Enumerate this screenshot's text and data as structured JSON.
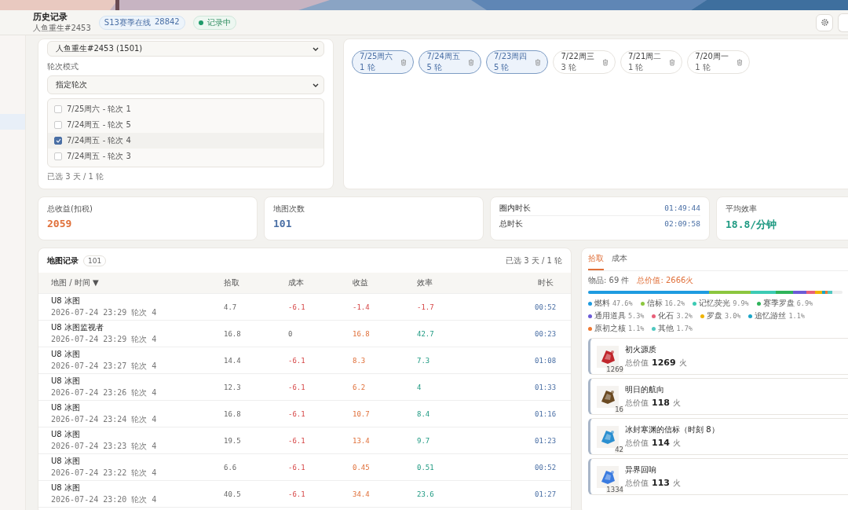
{
  "header": {
    "title": "历史记录",
    "subtitle": "人鱼重生#2453",
    "season_badge": {
      "label": "S13赛季在线",
      "count": "28842"
    },
    "status_badge": {
      "label": "记录中",
      "on": true
    }
  },
  "filter": {
    "character_select": "人鱼重生#2453 (1501)",
    "round_mode_label": "轮次模式",
    "round_mode_select": "指定轮次",
    "rounds": [
      {
        "label": "7/25周六 - 轮次 1",
        "checked": false
      },
      {
        "label": "7/24周五 - 轮次 5",
        "checked": false
      },
      {
        "label": "7/24周五 - 轮次 4",
        "checked": true
      },
      {
        "label": "7/24周五 - 轮次 3",
        "checked": false
      }
    ],
    "summary": "已选 3 天 / 1 轮"
  },
  "days": [
    {
      "label": "7/25周六",
      "rounds": "1 轮",
      "selected": true
    },
    {
      "label": "7/24周五",
      "rounds": "5 轮",
      "selected": true
    },
    {
      "label": "7/23周四",
      "rounds": "5 轮",
      "selected": true
    },
    {
      "label": "7/22周三",
      "rounds": "3 轮",
      "selected": false
    },
    {
      "label": "7/21周二",
      "rounds": "1 轮",
      "selected": false
    },
    {
      "label": "7/20周一",
      "rounds": "1 轮",
      "selected": false
    }
  ],
  "stats": [
    {
      "kind": "single",
      "label": "总收益(扣税)",
      "value": "2059",
      "color": "#e0703a"
    },
    {
      "kind": "single",
      "label": "地图次数",
      "value": "101",
      "color": "#4a6fa5"
    },
    {
      "kind": "pair",
      "rows": [
        {
          "label": "圈内时长",
          "value": "01:49:44"
        },
        {
          "label": "总时长",
          "value": "02:09:58"
        }
      ]
    },
    {
      "kind": "single",
      "label": "平均效率",
      "value": "18.8/分钟",
      "color": "#1f9a82"
    }
  ],
  "table": {
    "title": "地图记录",
    "count": "101",
    "summary": "已选 3 天 / 1 轮",
    "columns": [
      "地图 / 时间 ▼",
      "拾取",
      "成本",
      "收益",
      "效率",
      "时长"
    ],
    "rows": [
      {
        "map": "U8 冰图",
        "time": "2026-07-24 23:29  轮次 4",
        "pickup": "4.7",
        "cost": "-6.1",
        "profit": "-1.4",
        "efficiency": "-1.7",
        "duration": "00:52"
      },
      {
        "map": "U8 冰图监视者",
        "time": "2026-07-24 23:29  轮次 4",
        "pickup": "16.8",
        "cost": "0",
        "profit": "16.8",
        "efficiency": "42.7",
        "duration": "00:23"
      },
      {
        "map": "U8 冰图",
        "time": "2026-07-24 23:27  轮次 4",
        "pickup": "14.4",
        "cost": "-6.1",
        "profit": "8.3",
        "efficiency": "7.3",
        "duration": "01:08"
      },
      {
        "map": "U8 冰图",
        "time": "2026-07-24 23:26  轮次 4",
        "pickup": "12.3",
        "cost": "-6.1",
        "profit": "6.2",
        "efficiency": "4",
        "duration": "01:33"
      },
      {
        "map": "U8 冰图",
        "time": "2026-07-24 23:24  轮次 4",
        "pickup": "16.8",
        "cost": "-6.1",
        "profit": "10.7",
        "efficiency": "8.4",
        "duration": "01:16"
      },
      {
        "map": "U8 冰图",
        "time": "2026-07-24 23:23  轮次 4",
        "pickup": "19.5",
        "cost": "-6.1",
        "profit": "13.4",
        "efficiency": "9.7",
        "duration": "01:23"
      },
      {
        "map": "U8 冰图",
        "time": "2026-07-24 23:22  轮次 4",
        "pickup": "6.6",
        "cost": "-6.1",
        "profit": "0.45",
        "efficiency": "0.51",
        "duration": "00:52"
      },
      {
        "map": "U8 冰图",
        "time": "2026-07-24 23:20  轮次 4",
        "pickup": "40.5",
        "cost": "-6.1",
        "profit": "34.4",
        "efficiency": "23.6",
        "duration": "01:27"
      }
    ]
  },
  "loot": {
    "tabs": [
      {
        "label": "拾取",
        "selected": true
      },
      {
        "label": "成本",
        "selected": false
      }
    ],
    "item_count": "物品: 69 件",
    "total_value": "总价值: 2666火",
    "categories": [
      {
        "name": "燃料",
        "share": "47.6%",
        "color": "#1e9be0"
      },
      {
        "name": "信标",
        "share": "16.2%",
        "color": "#8cc63f"
      },
      {
        "name": "记忆荧光",
        "share": "9.9%",
        "color": "#3ccbb4"
      },
      {
        "name": "赛季罗盘",
        "share": "6.9%",
        "color": "#2fb35a"
      },
      {
        "name": "通用道具",
        "share": "5.3%",
        "color": "#6b5bd6"
      },
      {
        "name": "化石",
        "share": "3.2%",
        "color": "#e8607a"
      },
      {
        "name": "罗盘",
        "share": "3.0%",
        "color": "#f0b400"
      },
      {
        "name": "追忆游丝",
        "share": "1.1%",
        "color": "#1aa5c8"
      },
      {
        "name": "原初之核",
        "share": "1.1%",
        "color": "#f07830"
      },
      {
        "name": "其他",
        "share": "1.7%",
        "color": "#50c8c0"
      }
    ],
    "items": [
      {
        "name": "初火源质",
        "count": "1269",
        "value_label": "总价值",
        "value": "1269",
        "unit": "火"
      },
      {
        "name": "明日的航向",
        "count": "16",
        "value_label": "总价值",
        "value": "118",
        "unit": "火"
      },
      {
        "name": "冰封寒渊的信标（时刻 8）",
        "count": "42",
        "value_label": "总价值",
        "value": "114",
        "unit": "火"
      },
      {
        "name": "异界回响",
        "count": "1334",
        "value_label": "总价值",
        "value": "113",
        "unit": "火"
      }
    ]
  }
}
